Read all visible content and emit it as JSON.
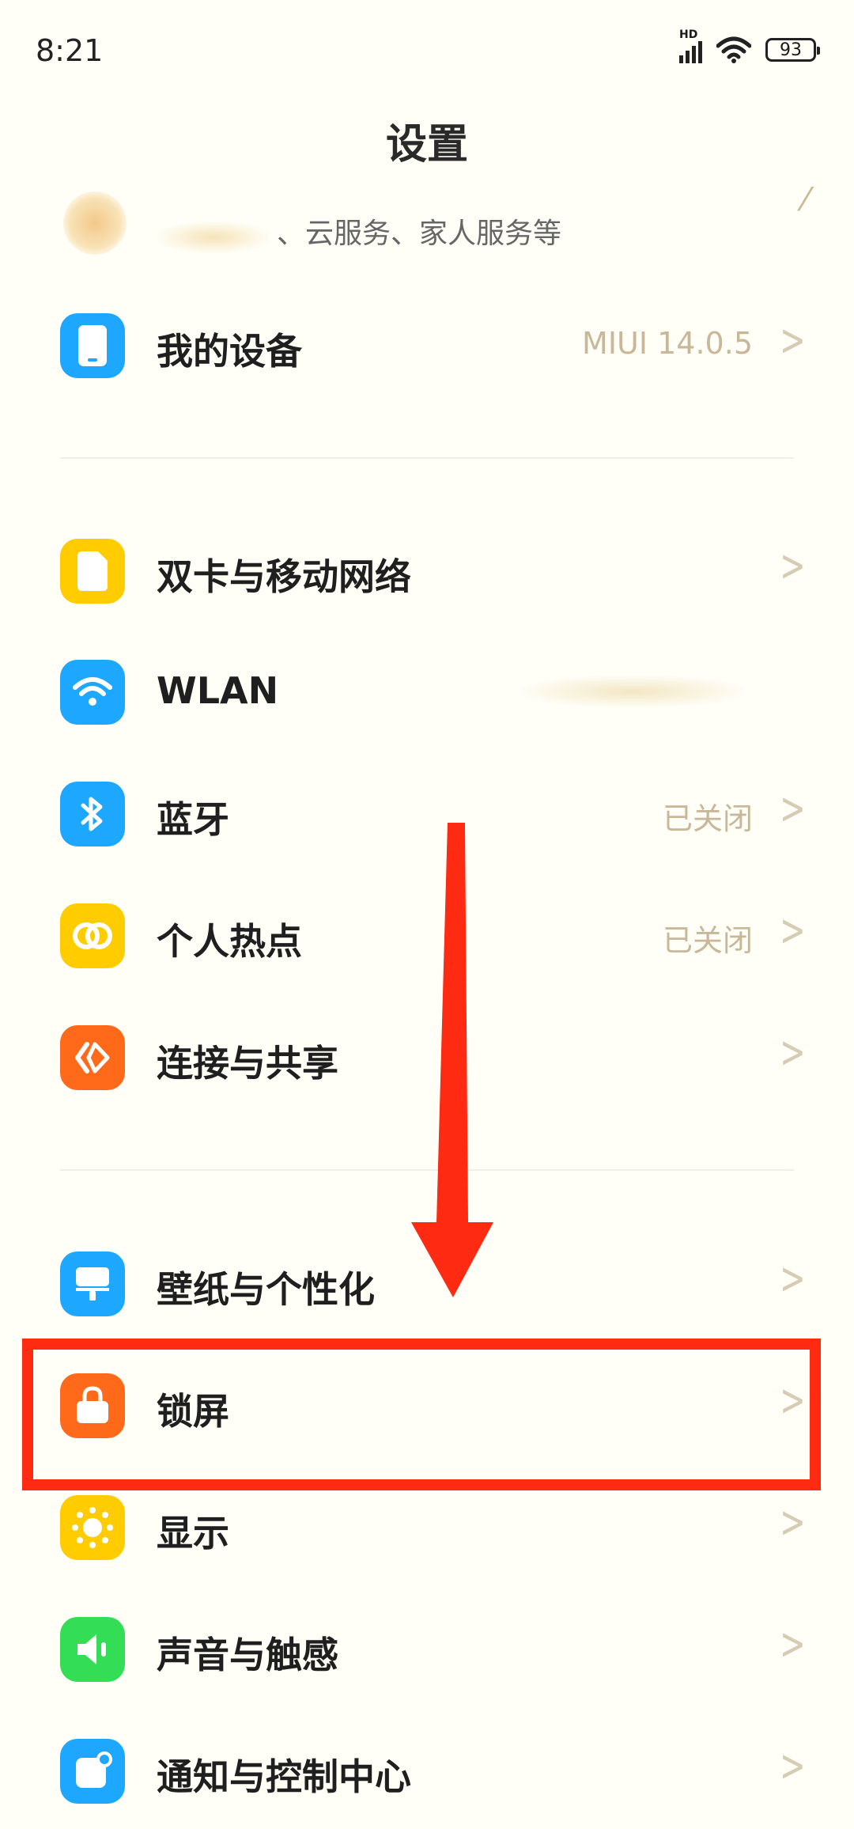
{
  "status_bar": {
    "time": "8:21",
    "network_badge": "HD",
    "battery_level": "93"
  },
  "header": {
    "title": "设置"
  },
  "account": {
    "subtitle": "、云服务、家人服务等"
  },
  "rows": [
    {
      "label": "我的设备",
      "value": "MIUI 14.0.5",
      "icon": "phone-icon",
      "color": "#1ea7ff"
    },
    {
      "label": "双卡与移动网络",
      "value": "",
      "icon": "sim-card-icon",
      "color": "#ffcc00"
    },
    {
      "label": "WLAN",
      "value": "",
      "icon": "wifi-icon",
      "color": "#1ea7ff"
    },
    {
      "label": "蓝牙",
      "value": "已关闭",
      "icon": "bluetooth-icon",
      "color": "#1ea7ff"
    },
    {
      "label": "个人热点",
      "value": "已关闭",
      "icon": "hotspot-icon",
      "color": "#ffcc00"
    },
    {
      "label": "连接与共享",
      "value": "",
      "icon": "share-icon",
      "color": "#ff6a1a"
    },
    {
      "label": "壁纸与个性化",
      "value": "",
      "icon": "wallpaper-icon",
      "color": "#1ea7ff"
    },
    {
      "label": "锁屏",
      "value": "",
      "icon": "lock-icon",
      "color": "#ff6a1a"
    },
    {
      "label": "显示",
      "value": "",
      "icon": "sun-icon",
      "color": "#ffcc00"
    },
    {
      "label": "声音与触感",
      "value": "",
      "icon": "speaker-icon",
      "color": "#33dd55"
    },
    {
      "label": "通知与控制中心",
      "value": "",
      "icon": "notification-icon",
      "color": "#1ea7ff"
    }
  ],
  "annotations": {
    "arrow_color": "#ff2a12",
    "highlight_color": "#ff2a12"
  }
}
